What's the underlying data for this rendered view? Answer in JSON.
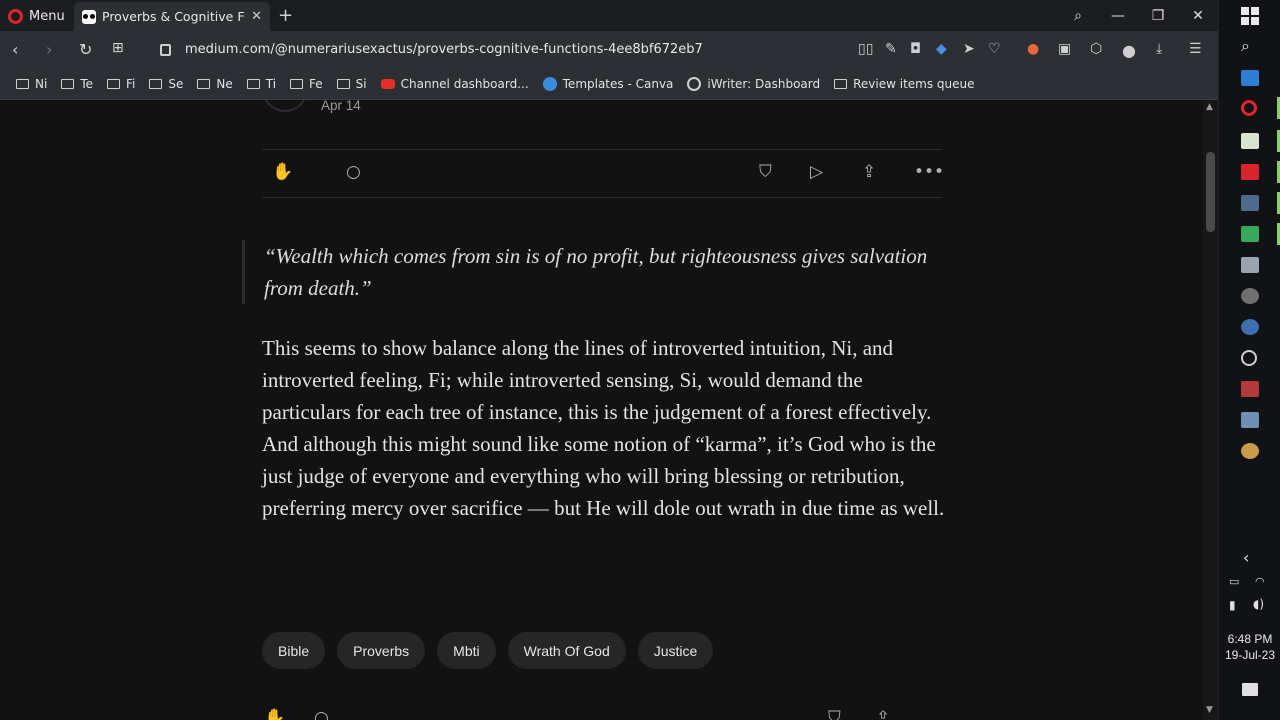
{
  "browser": {
    "menu_label": "Menu",
    "tab_title": "Proverbs & Cognitive Functions",
    "url": "medium.com/@numerariusexactus/proverbs-cognitive-functions-4ee8bf672eb7",
    "bookmarks": [
      "Ni",
      "Te",
      "Fi",
      "Se",
      "Ne",
      "Ti",
      "Fe",
      "Si",
      "Channel dashboard...",
      "Templates - Canva",
      "iWriter: Dashboard",
      "Review items queue"
    ]
  },
  "article": {
    "date": "Apr 14",
    "quote": "“Wealth which comes from sin is of no profit, but righteousness gives salvation from death.”",
    "paragraph": "This seems to show balance along the lines of introverted intuition, Ni, and introverted feeling, Fi; while introverted sensing, Si, would demand the particulars for each tree of instance, this is the judgement of a forest effectively. And although this might sound like some notion of “karma”, it’s God who is the just judge of everyone and everything who will bring blessing or retribution, preferring mercy over sacrifice — but He will dole out wrath in due time as well.",
    "tags": [
      "Bible",
      "Proverbs",
      "Mbti",
      "Wrath Of God",
      "Justice"
    ]
  },
  "system": {
    "time": "6:48 PM",
    "date": "19-Jul-23"
  },
  "colors": {
    "page_bg": "#121212",
    "chrome_bg": "#2c2f34",
    "tag_bg": "#262626",
    "opera_red": "#e0242e"
  }
}
